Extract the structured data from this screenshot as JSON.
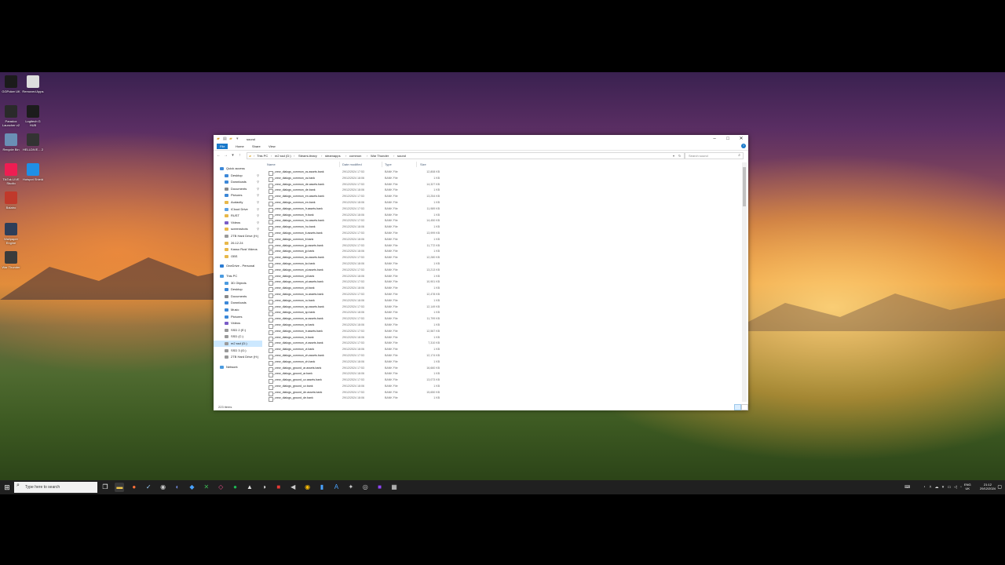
{
  "desktop": {
    "icons": [
      {
        "label": "GGPoker UK",
        "color": "#1b1b1b"
      },
      {
        "label": "Removed Apps",
        "color": "#dddddd"
      },
      {
        "label": "Paradox Launcher v2",
        "color": "#2a2a2a"
      },
      {
        "label": "Logitech G HUB",
        "color": "#1c1c1c"
      },
      {
        "label": "Recycle Bin",
        "color": "#6a8fb5"
      },
      {
        "label": "HELLDIVE... 2",
        "color": "#333333"
      },
      {
        "label": "TikTok LIVE Studio",
        "color": "#ee1d52"
      },
      {
        "label": "Hotspot Shield",
        "color": "#1f8fe5"
      },
      {
        "label": "Balatro",
        "color": "#c0392b"
      },
      {
        "label": "Wallpaper Engine",
        "color": "#2d3e59"
      },
      {
        "label": "War Thunder",
        "color": "#3b3b3b"
      }
    ]
  },
  "explorer": {
    "title": "sound",
    "tabs": [
      "File",
      "Home",
      "Share",
      "View"
    ],
    "breadcrumb": [
      "This PC",
      "m2 ssd (D:)",
      "SteamLibrary",
      "steamapps",
      "common",
      "War Thunder",
      "sound"
    ],
    "search_placeholder": "Search sound",
    "columns": {
      "name": "Name",
      "date": "Date modified",
      "type": "Type",
      "size": "Size"
    },
    "nav": [
      {
        "label": "Quick access",
        "indent": 0,
        "color": "#3c88d8"
      },
      {
        "label": "Desktop",
        "indent": 1,
        "color": "#3c88d8",
        "pin": true
      },
      {
        "label": "Downloads",
        "indent": 1,
        "color": "#3c88d8",
        "pin": true
      },
      {
        "label": "Documents",
        "indent": 1,
        "color": "#8a8a8a",
        "pin": true
      },
      {
        "label": "Pictures",
        "indent": 1,
        "color": "#3c88d8",
        "pin": true
      },
      {
        "label": "Audacity",
        "indent": 1,
        "color": "#e8b84a",
        "pin": true
      },
      {
        "label": "iCloud Drive",
        "indent": 1,
        "color": "#5aa0e6",
        "pin": true
      },
      {
        "label": "RUST",
        "indent": 1,
        "color": "#e8b84a",
        "pin": true
      },
      {
        "label": "Videos",
        "indent": 1,
        "color": "#7a5cc7",
        "pin": true
      },
      {
        "label": "screenshots",
        "indent": 1,
        "color": "#e8b84a",
        "pin": true
      },
      {
        "label": "2TB Hard Drive (H:)",
        "indent": 1,
        "color": "#9a9a9a"
      },
      {
        "label": "26.12.24",
        "indent": 1,
        "color": "#e8b84a"
      },
      {
        "label": "Kasso Rust Videos",
        "indent": 1,
        "color": "#e8b84a"
      },
      {
        "label": "OBS",
        "indent": 1,
        "color": "#e8b84a"
      },
      {
        "label": "OneDrive - Personal",
        "indent": 0,
        "color": "#2b7cd3"
      },
      {
        "label": "This PC",
        "indent": 0,
        "color": "#4b9be0"
      },
      {
        "label": "3D Objects",
        "indent": 1,
        "color": "#4b9be0"
      },
      {
        "label": "Desktop",
        "indent": 1,
        "color": "#3c88d8"
      },
      {
        "label": "Documents",
        "indent": 1,
        "color": "#8a8a8a"
      },
      {
        "label": "Downloads",
        "indent": 1,
        "color": "#3c88d8"
      },
      {
        "label": "Music",
        "indent": 1,
        "color": "#3c88d8"
      },
      {
        "label": "Pictures",
        "indent": 1,
        "color": "#3c88d8"
      },
      {
        "label": "Videos",
        "indent": 1,
        "color": "#7a5cc7"
      },
      {
        "label": "SSD 2 (E:)",
        "indent": 1,
        "color": "#9a9a9a"
      },
      {
        "label": "SSD (C:)",
        "indent": 1,
        "color": "#9a9a9a"
      },
      {
        "label": "m2 ssd (D:)",
        "indent": 1,
        "color": "#9a9a9a",
        "selected": true
      },
      {
        "label": "SSD 3 (G:)",
        "indent": 1,
        "color": "#9a9a9a"
      },
      {
        "label": "2TB Hard Drive (H:)",
        "indent": 1,
        "color": "#9a9a9a"
      },
      {
        "label": "Network",
        "indent": 0,
        "color": "#4b9be0"
      }
    ],
    "files": [
      {
        "name": "_crew_dialogs_common_cs.assets.bank",
        "date": "29/12/2024 17:53",
        "type": "BANK File",
        "size": "12,808 KB"
      },
      {
        "name": "_crew_dialogs_common_cs.bank",
        "date": "29/12/2024 18:06",
        "type": "BANK File",
        "size": "1 KB"
      },
      {
        "name": "_crew_dialogs_common_de.assets.bank",
        "date": "29/12/2024 17:53",
        "type": "BANK File",
        "size": "14,327 KB"
      },
      {
        "name": "_crew_dialogs_common_de.bank",
        "date": "29/12/2024 18:06",
        "type": "BANK File",
        "size": "1 KB"
      },
      {
        "name": "_crew_dialogs_common_en.assets.bank",
        "date": "29/12/2024 17:53",
        "type": "BANK File",
        "size": "13,254 KB"
      },
      {
        "name": "_crew_dialogs_common_en.bank",
        "date": "29/12/2024 18:06",
        "type": "BANK File",
        "size": "1 KB"
      },
      {
        "name": "_crew_dialogs_common_fr.assets.bank",
        "date": "29/12/2024 17:53",
        "type": "BANK File",
        "size": "11,989 KB"
      },
      {
        "name": "_crew_dialogs_common_fr.bank",
        "date": "29/12/2024 18:06",
        "type": "BANK File",
        "size": "1 KB"
      },
      {
        "name": "_crew_dialogs_common_hu.assets.bank",
        "date": "29/12/2024 17:53",
        "type": "BANK File",
        "size": "14,450 KB"
      },
      {
        "name": "_crew_dialogs_common_hu.bank",
        "date": "29/12/2024 18:06",
        "type": "BANK File",
        "size": "1 KB"
      },
      {
        "name": "_crew_dialogs_common_it.assets.bank",
        "date": "29/12/2024 17:53",
        "type": "BANK File",
        "size": "13,999 KB"
      },
      {
        "name": "_crew_dialogs_common_it.bank",
        "date": "29/12/2024 18:06",
        "type": "BANK File",
        "size": "1 KB"
      },
      {
        "name": "_crew_dialogs_common_jp.assets.bank",
        "date": "29/12/2024 17:53",
        "type": "BANK File",
        "size": "11,772 KB"
      },
      {
        "name": "_crew_dialogs_common_jp.bank",
        "date": "29/12/2024 18:06",
        "type": "BANK File",
        "size": "1 KB"
      },
      {
        "name": "_crew_dialogs_common_ko.assets.bank",
        "date": "29/12/2024 17:53",
        "type": "BANK File",
        "size": "12,280 KB"
      },
      {
        "name": "_crew_dialogs_common_ko.bank",
        "date": "29/12/2024 18:06",
        "type": "BANK File",
        "size": "1 KB"
      },
      {
        "name": "_crew_dialogs_common_pl.assets.bank",
        "date": "29/12/2024 17:53",
        "type": "BANK File",
        "size": "13,213 KB"
      },
      {
        "name": "_crew_dialogs_common_pl.bank",
        "date": "29/12/2024 18:06",
        "type": "BANK File",
        "size": "1 KB"
      },
      {
        "name": "_crew_dialogs_common_pt.assets.bank",
        "date": "29/12/2024 17:53",
        "type": "BANK File",
        "size": "10,901 KB"
      },
      {
        "name": "_crew_dialogs_common_pt.bank",
        "date": "29/12/2024 18:06",
        "type": "BANK File",
        "size": "1 KB"
      },
      {
        "name": "_crew_dialogs_common_ru.assets.bank",
        "date": "29/12/2024 17:53",
        "type": "BANK File",
        "size": "12,478 KB"
      },
      {
        "name": "_crew_dialogs_common_ru.bank",
        "date": "29/12/2024 18:06",
        "type": "BANK File",
        "size": "1 KB"
      },
      {
        "name": "_crew_dialogs_common_sp.assets.bank",
        "date": "29/12/2024 17:53",
        "type": "BANK File",
        "size": "12,149 KB"
      },
      {
        "name": "_crew_dialogs_common_sp.bank",
        "date": "29/12/2024 18:06",
        "type": "BANK File",
        "size": "1 KB"
      },
      {
        "name": "_crew_dialogs_common_sr.assets.bank",
        "date": "29/12/2024 17:53",
        "type": "BANK File",
        "size": "11,799 KB"
      },
      {
        "name": "_crew_dialogs_common_sr.bank",
        "date": "29/12/2024 18:06",
        "type": "BANK File",
        "size": "1 KB"
      },
      {
        "name": "_crew_dialogs_common_tr.assets.bank",
        "date": "29/12/2024 17:53",
        "type": "BANK File",
        "size": "12,567 KB"
      },
      {
        "name": "_crew_dialogs_common_tr.bank",
        "date": "29/12/2024 18:06",
        "type": "BANK File",
        "size": "1 KB"
      },
      {
        "name": "_crew_dialogs_common_vi.assets.bank",
        "date": "29/12/2024 17:53",
        "type": "BANK File",
        "size": "7,310 KB"
      },
      {
        "name": "_crew_dialogs_common_vi.bank",
        "date": "29/12/2024 18:06",
        "type": "BANK File",
        "size": "1 KB"
      },
      {
        "name": "_crew_dialogs_common_zh.assets.bank",
        "date": "29/12/2024 17:53",
        "type": "BANK File",
        "size": "12,174 KB"
      },
      {
        "name": "_crew_dialogs_common_zh.bank",
        "date": "29/12/2024 18:06",
        "type": "BANK File",
        "size": "1 KB"
      },
      {
        "name": "_crew_dialogs_ground_ar.assets.bank",
        "date": "29/12/2024 17:53",
        "type": "BANK File",
        "size": "16,660 KB"
      },
      {
        "name": "_crew_dialogs_ground_ar.bank",
        "date": "29/12/2024 18:06",
        "type": "BANK File",
        "size": "1 KB"
      },
      {
        "name": "_crew_dialogs_ground_cz.assets.bank",
        "date": "29/12/2024 17:53",
        "type": "BANK File",
        "size": "13,073 KB"
      },
      {
        "name": "_crew_dialogs_ground_cz.bank",
        "date": "29/12/2024 18:06",
        "type": "BANK File",
        "size": "1 KB"
      },
      {
        "name": "_crew_dialogs_ground_de.assets.bank",
        "date": "29/12/2024 17:53",
        "type": "BANK File",
        "size": "15,650 KB"
      },
      {
        "name": "_crew_dialogs_ground_de.bank",
        "date": "29/12/2024 18:06",
        "type": "BANK File",
        "size": "1 KB"
      }
    ],
    "status": "223 items"
  },
  "taskbar": {
    "search_placeholder": "Type here to search",
    "lang": [
      "ENG",
      "UK"
    ],
    "time": "21:12",
    "date": "29/12/2024",
    "apps": [
      {
        "icon": "task-view-icon",
        "glyph": "❐",
        "color": "#ffffff",
        "bg": "transparent"
      },
      {
        "icon": "file-explorer-icon",
        "glyph": "▬",
        "color": "#f2c94c",
        "bg": "#3a3a3a"
      },
      {
        "icon": "firefox-icon",
        "glyph": "●",
        "color": "#ff7139",
        "bg": "transparent"
      },
      {
        "icon": "steam-icon",
        "glyph": "✓",
        "color": "#9ad0ff",
        "bg": "transparent"
      },
      {
        "icon": "obs-icon",
        "glyph": "◉",
        "color": "#cccccc",
        "bg": "transparent"
      },
      {
        "icon": "discord-icon",
        "glyph": "◐",
        "color": "#7289da",
        "bg": "transparent"
      },
      {
        "icon": "store-icon",
        "glyph": "◆",
        "color": "#4aa3ff",
        "bg": "transparent"
      },
      {
        "icon": "xbox-icon",
        "glyph": "✕",
        "color": "#3cba54",
        "bg": "transparent"
      },
      {
        "icon": "app-icon",
        "glyph": "◇",
        "color": "#e84d8a",
        "bg": "transparent"
      },
      {
        "icon": "app-icon",
        "glyph": "●",
        "color": "#1db954",
        "bg": "transparent"
      },
      {
        "icon": "app-icon",
        "glyph": "▲",
        "color": "#dddddd",
        "bg": "transparent"
      },
      {
        "icon": "app-icon",
        "glyph": "◑",
        "color": "#eeeeee",
        "bg": "transparent"
      },
      {
        "icon": "app-icon",
        "glyph": "■",
        "color": "#e53935",
        "bg": "transparent"
      },
      {
        "icon": "app-icon",
        "glyph": "◀",
        "color": "#cccccc",
        "bg": "transparent"
      },
      {
        "icon": "chrome-icon",
        "glyph": "◉",
        "color": "#fbbc05",
        "bg": "transparent"
      },
      {
        "icon": "app-icon",
        "glyph": "▮",
        "color": "#4aa3ff",
        "bg": "transparent"
      },
      {
        "icon": "app-icon",
        "glyph": "A",
        "color": "#4aa3ff",
        "bg": "transparent"
      },
      {
        "icon": "app-icon",
        "glyph": "✦",
        "color": "#cccccc",
        "bg": "transparent"
      },
      {
        "icon": "app-icon",
        "glyph": "◎",
        "color": "#cccccc",
        "bg": "transparent"
      },
      {
        "icon": "app-icon",
        "glyph": "■",
        "color": "#9146ff",
        "bg": "transparent"
      },
      {
        "icon": "app-icon",
        "glyph": "▦",
        "color": "#dddddd",
        "bg": "transparent"
      }
    ]
  }
}
